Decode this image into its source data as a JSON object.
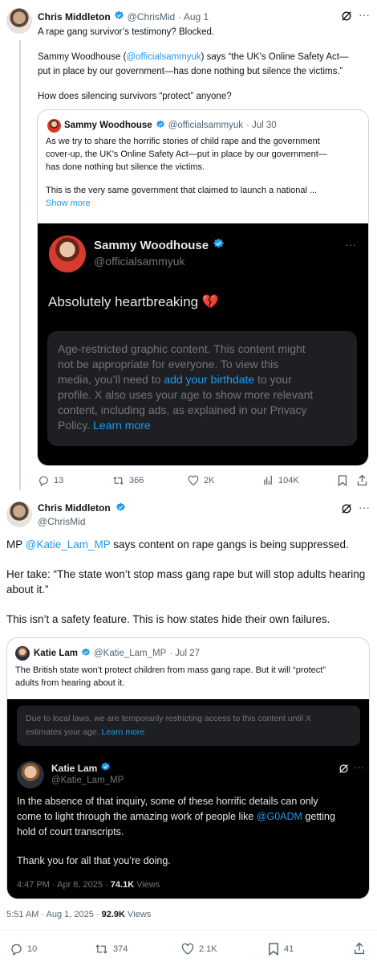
{
  "tweet1": {
    "author": "Chris Middleton",
    "handle": "@ChrisMid",
    "date": "· Aug 1",
    "line1": "A rape gang survivor’s testimony? Blocked.",
    "p2_prefix": "Sammy Woodhouse (",
    "p2_mention": "@officialsammyuk",
    "p2_suffix": ") says “the UK’s Online Safety Act—",
    "p2_line2": "put in place by our government—has done nothing but silence the victims.”",
    "p3": "How does silencing survivors “protect” anyone?",
    "quote": {
      "author": "Sammy Woodhouse",
      "handle": "@officialsammyuk",
      "date": "· Jul 30",
      "line1": "As we try to share the horrific stories of child rape and the government",
      "line2": "cover-up, the UK’s Online Safety Act—put in place by our government—",
      "line3": "has done nothing but silence the victims.",
      "line4": "This is the very same government that claimed to launch a national ...",
      "show_more": "Show more",
      "embed": {
        "author": "Sammy Woodhouse",
        "handle": "@officialsammyuk",
        "text": "Absolutely heartbreaking 💔",
        "notice_l1": "Age-restricted graphic content. This content might",
        "notice_l2": "not be appropriate for everyone. To view this",
        "notice_l3_pre": "media, you’ll need to ",
        "notice_l3_link": "add your birthdate",
        "notice_l3_post": " to your",
        "notice_l4": "profile. X also uses your age to show more relevant",
        "notice_l5": "content, including ads, as explained in our Privacy",
        "notice_l6_pre": "Policy. ",
        "notice_l6_link": "Learn more"
      }
    },
    "stats": {
      "replies": "13",
      "reposts": "366",
      "likes": "2K",
      "views": "104K"
    }
  },
  "tweet2": {
    "author": "Chris Middleton",
    "handle": "@ChrisMid",
    "p1_prefix": "MP ",
    "p1_mention": "@Katie_Lam_MP",
    "p1_suffix": " says content on rape gangs is being suppressed.",
    "p2_l1": "Her take: “The state won’t stop mass gang rape but will stop adults hearing",
    "p2_l2": "about it.”",
    "p3": "This isn’t a safety feature. This is how states hide their own failures.",
    "quote": {
      "author": "Katie Lam",
      "handle": "@Katie_Lam_MP",
      "date": "· Jul 27",
      "line1": "The British state won’t protect children from mass gang rape. But it will “protect”",
      "line2": "adults from hearing about it.",
      "notice_l1": "Due to local laws, we are temporarily restricting access to this content until X",
      "notice_l2_pre": "estimates your age. ",
      "notice_l2_link": "Learn more",
      "embed": {
        "author": "Katie Lam",
        "handle": "@Katie_Lam_MP",
        "l1": "In the absence of that inquiry, some of these horrific details can only",
        "l2": "come to light through the amazing work of people like ",
        "l2_link": "@G0ADM",
        "l2_post": " getting",
        "l3": "hold of court transcripts.",
        "l4": "Thank you for all that you’re doing.",
        "meta": "4:47 PM · Apr 8, 2025 · ",
        "views_num": "74.1K",
        "views_label": " Views"
      }
    },
    "meta": "5:51 AM · Aug 1, 2025 · ",
    "views_num": "92.9K",
    "views_label": " Views",
    "stats": {
      "replies": "10",
      "reposts": "374",
      "likes": "2.1K",
      "bookmarks": "41"
    }
  },
  "colors": {
    "accent": "#1d9bf0",
    "text": "#0f1419",
    "muted": "#536471",
    "border": "#cfd9de"
  }
}
